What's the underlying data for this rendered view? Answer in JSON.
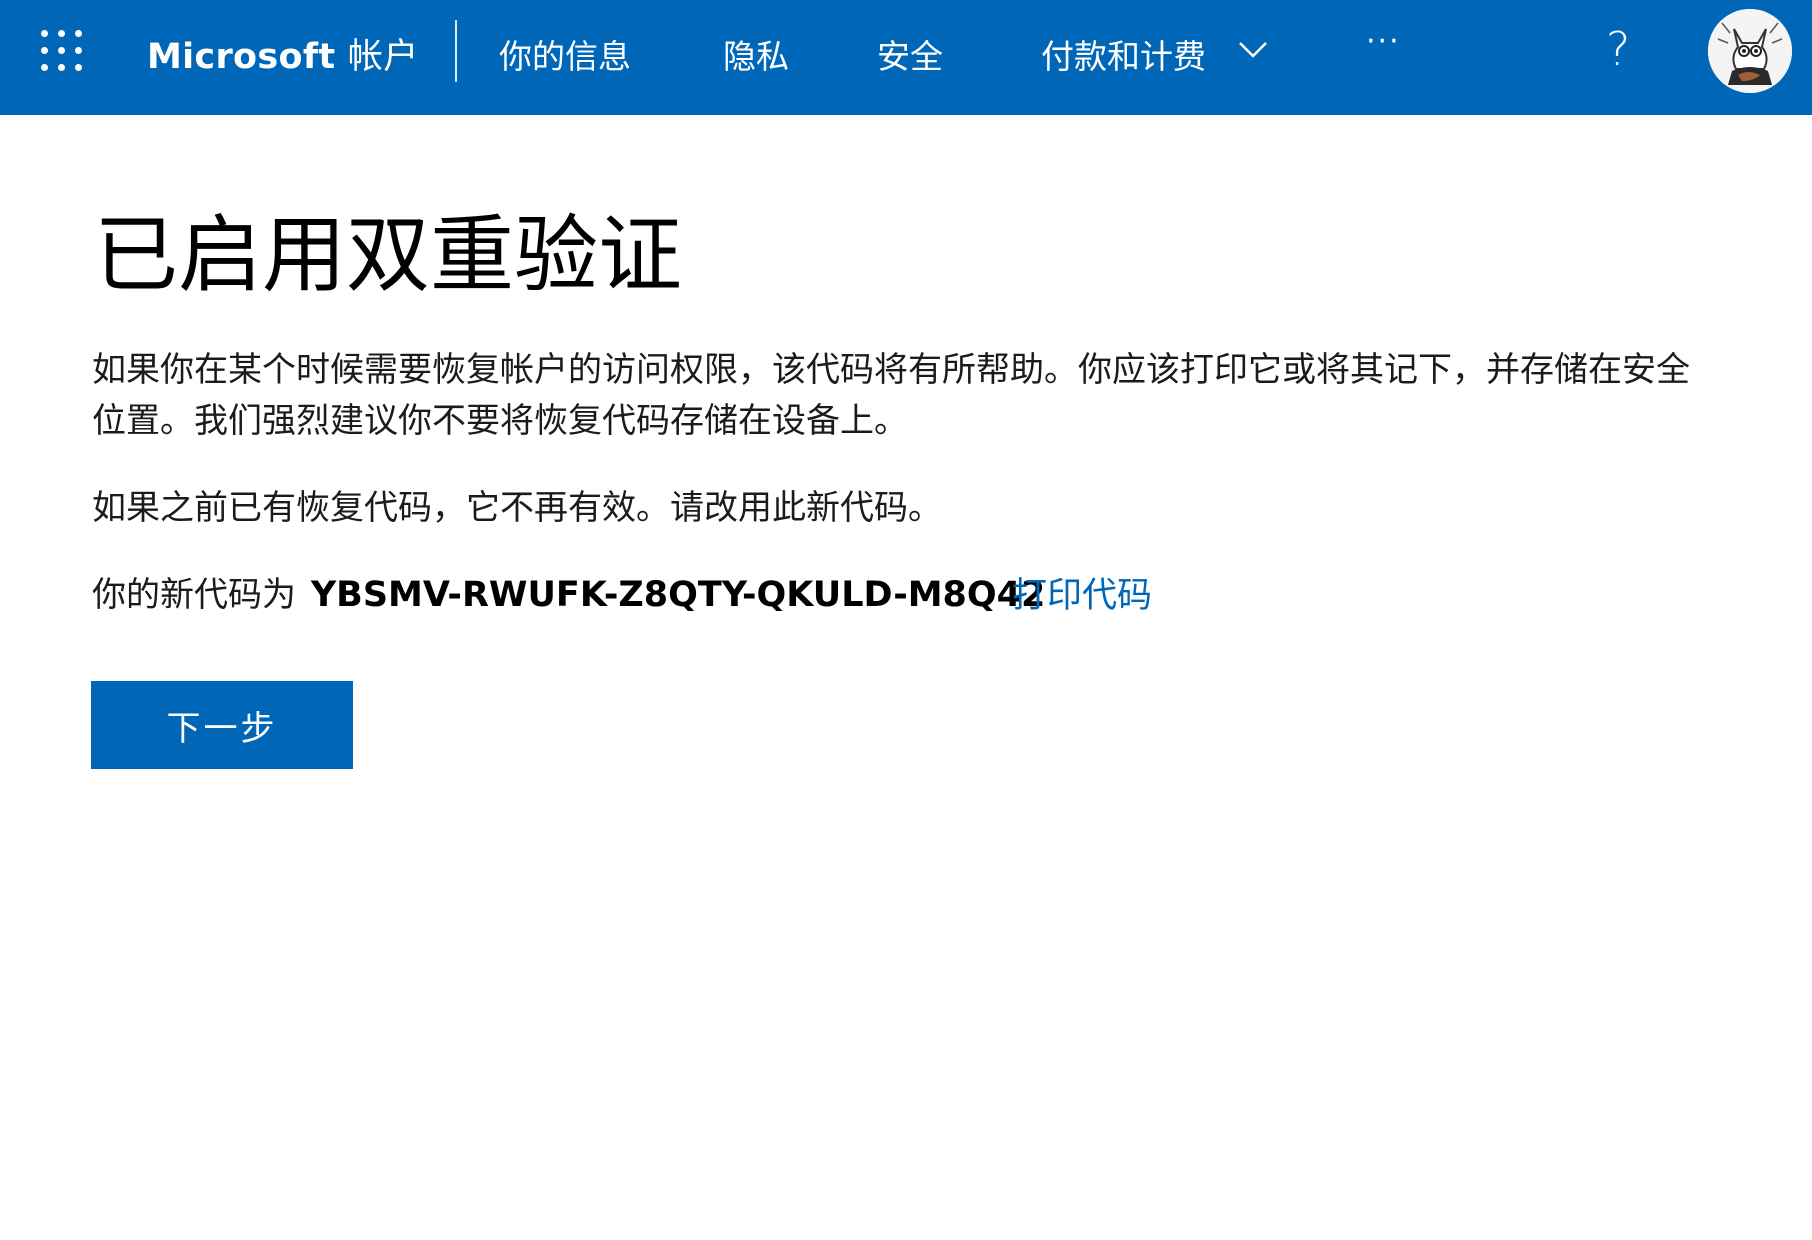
{
  "header": {
    "brand": "Microsoft",
    "brand_suffix": "帐户",
    "nav": {
      "your_info": "你的信息",
      "privacy": "隐私",
      "security": "安全",
      "billing": "付款和计费"
    },
    "more_label": "···",
    "help_label": "?"
  },
  "main": {
    "title": "已启用双重验证",
    "paragraph1": "如果你在某个时候需要恢复帐户的访问权限，该代码将有所帮助。你应该打印它或将其记下，并存储在安全位置。我们强烈建议你不要将恢复代码存储在设备上。",
    "paragraph2": "如果之前已有恢复代码，它不再有效。请改用此新代码。",
    "code_prefix": "你的新代码为",
    "code": "YBSMV-RWUFK-Z8QTY-QKULD-M8Q42",
    "print_link": "打印代码",
    "next_button": "下一步"
  },
  "colors": {
    "brand_blue": "#0067b8",
    "text": "#1b1b1b",
    "background": "#ffffff"
  },
  "icons": {
    "launcher": "app-launcher-icon",
    "dropdown": "chevron-down-icon",
    "help": "help-icon",
    "avatar": "avatar"
  }
}
